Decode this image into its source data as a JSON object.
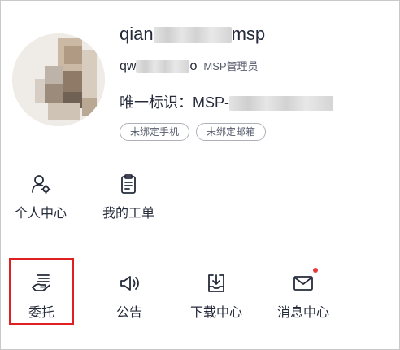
{
  "profile": {
    "username_prefix": "qian",
    "username_suffix": "msp",
    "account_prefix": "qw",
    "account_suffix": "o",
    "role": "MSP管理员",
    "uid_label": "唯一标识：",
    "uid_prefix": "MSP-",
    "bind_phone": "未绑定手机",
    "bind_email": "未绑定邮箱"
  },
  "row1": [
    {
      "label": "个人中心",
      "icon": "user-settings-icon"
    },
    {
      "label": "我的工单",
      "icon": "clipboard-icon"
    }
  ],
  "row2": [
    {
      "label": "委托",
      "icon": "hand-delegate-icon"
    },
    {
      "label": "公告",
      "icon": "megaphone-icon"
    },
    {
      "label": "下载中心",
      "icon": "download-tray-icon"
    },
    {
      "label": "消息中心",
      "icon": "mail-icon"
    }
  ],
  "colors": {
    "accent_red": "#e02020",
    "notification_dot": "#e4393c",
    "text": "#252b3a"
  }
}
